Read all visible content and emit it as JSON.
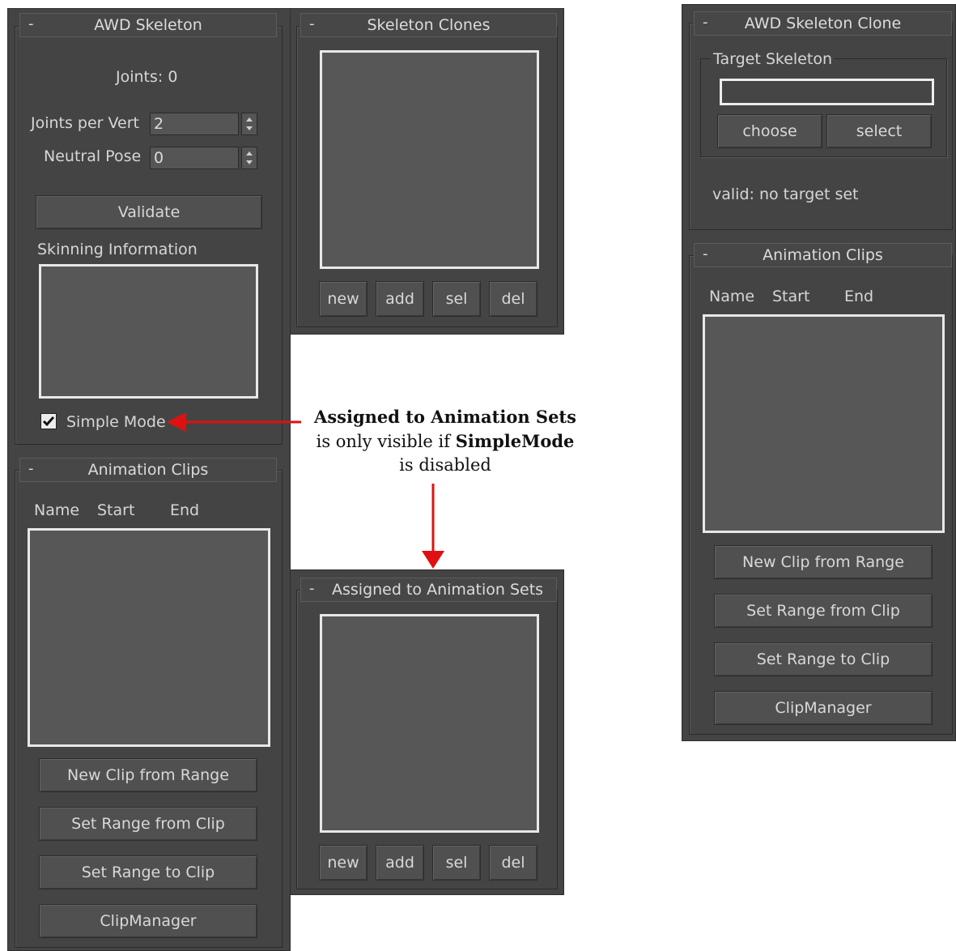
{
  "awd_skeleton": {
    "title": "AWD Skeleton",
    "collapse": "-",
    "joints_text": "Joints: 0",
    "joints_per_vert_label": "Joints per Vert",
    "joints_per_vert_value": "2",
    "neutral_pose_label": "Neutral Pose",
    "neutral_pose_value": "0",
    "validate_label": "Validate",
    "skinning_label": "Skinning Information",
    "simple_mode_label": "Simple Mode",
    "simple_mode_checked": true
  },
  "skeleton_clones": {
    "title": "Skeleton Clones",
    "collapse": "-",
    "buttons": [
      "new",
      "add",
      "sel",
      "del"
    ]
  },
  "animation_clips_left": {
    "title": "Animation Clips",
    "collapse": "-",
    "columns": [
      "Name",
      "Start",
      "End"
    ],
    "buttons": [
      "New Clip from Range",
      "Set Range from Clip",
      "Set Range to Clip",
      "ClipManager"
    ]
  },
  "assigned_sets": {
    "title": "Assigned to Animation Sets",
    "collapse": "-",
    "buttons": [
      "new",
      "add",
      "sel",
      "del"
    ]
  },
  "annotation": {
    "line1": "Assigned to Animation Sets",
    "line2_pre": "is only visible if ",
    "line2_bold": "SimpleMode",
    "line3": "is disabled",
    "arrow_color": "#e01010"
  },
  "skeleton_clone": {
    "title": "AWD Skeleton Clone",
    "collapse": "-",
    "target_label": "Target Skeleton",
    "target_value": "",
    "choose_label": "choose",
    "select_label": "select",
    "valid_text": "valid: no target set"
  },
  "animation_clips_right": {
    "title": "Animation Clips",
    "collapse": "-",
    "columns": [
      "Name",
      "Start",
      "End"
    ],
    "buttons": [
      "New Clip from Range",
      "Set Range from Clip",
      "Set Range to Clip",
      "ClipManager"
    ]
  }
}
